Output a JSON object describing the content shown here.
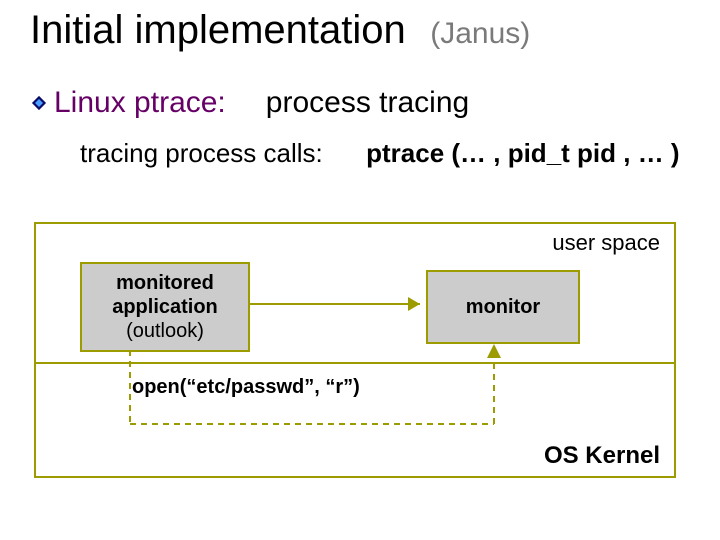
{
  "title": {
    "main": "Initial implementation",
    "sub": "(Janus)"
  },
  "bullet": {
    "label": "Linux ptrace:",
    "rest": "process tracing"
  },
  "subline": {
    "prefix": "tracing process calls:",
    "call": "ptrace (… ,  pid_t pid ,  … )"
  },
  "diagram": {
    "user_space": "user space",
    "os_kernel": "OS Kernel",
    "monitored_line1": "monitored",
    "monitored_line2": "application",
    "monitored_line3": "(outlook)",
    "monitor": "monitor",
    "syscall": "open(“etc/passwd”,  “r”)"
  },
  "colors": {
    "accent": "#9c9c00",
    "bullet_text": "#660066",
    "subtitle": "#7a7a7a",
    "box_bg": "#cccccc"
  }
}
